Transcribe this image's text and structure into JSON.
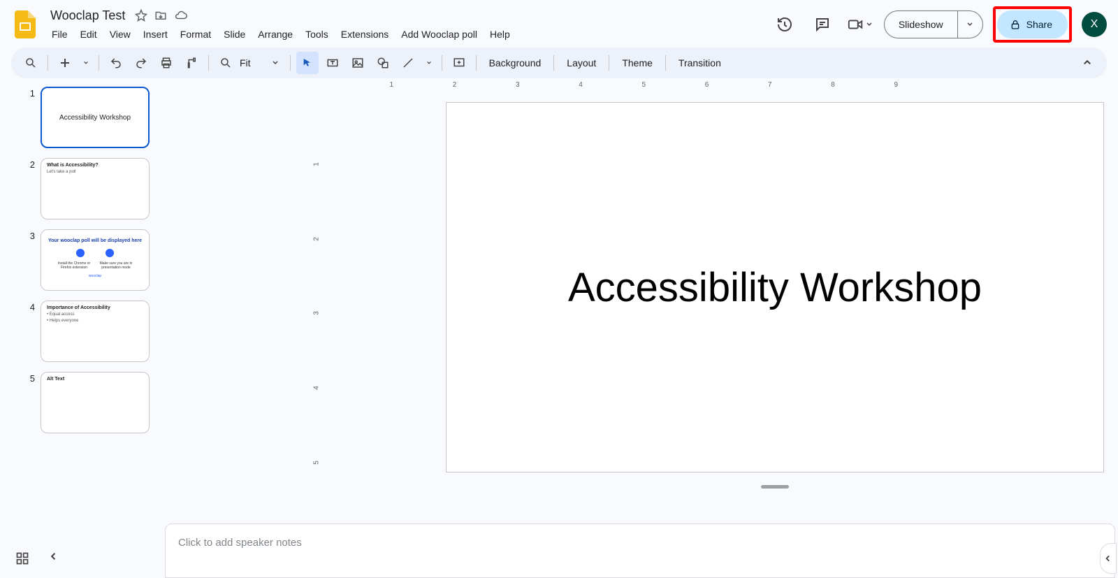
{
  "doc": {
    "title": "Wooclap Test"
  },
  "menu": [
    "File",
    "Edit",
    "View",
    "Insert",
    "Format",
    "Slide",
    "Arrange",
    "Tools",
    "Extensions",
    "Add Wooclap poll",
    "Help"
  ],
  "header": {
    "slideshow": "Slideshow",
    "share": "Share",
    "avatar": "X"
  },
  "toolbar": {
    "zoom_label": "Fit",
    "background": "Background",
    "layout": "Layout",
    "theme": "Theme",
    "transition": "Transition"
  },
  "ruler_h": [
    "1",
    "2",
    "3",
    "4",
    "5",
    "6",
    "7",
    "8",
    "9"
  ],
  "ruler_v": [
    "1",
    "2",
    "3",
    "4",
    "5"
  ],
  "slides": [
    {
      "num": "1",
      "type": "title",
      "title": "Accessibility Workshop",
      "selected": true
    },
    {
      "num": "2",
      "type": "content",
      "title": "What is Accessibility?",
      "sub": "Let's take a poll"
    },
    {
      "num": "3",
      "type": "wooclap",
      "title": "Your wooclap poll will be displayed here",
      "left_caption": "Install the Chrome or Firefox extension",
      "right_caption": "Make sure you are in presentation mode",
      "footer": "wooclap"
    },
    {
      "num": "4",
      "type": "content",
      "title": "Importance of Accessibility",
      "bullets": [
        "Equal access",
        "Helps everyone"
      ]
    },
    {
      "num": "5",
      "type": "content",
      "title": "Alt Text"
    }
  ],
  "canvas": {
    "title": "Accessibility Workshop"
  },
  "notes": {
    "placeholder": "Click to add speaker notes"
  }
}
